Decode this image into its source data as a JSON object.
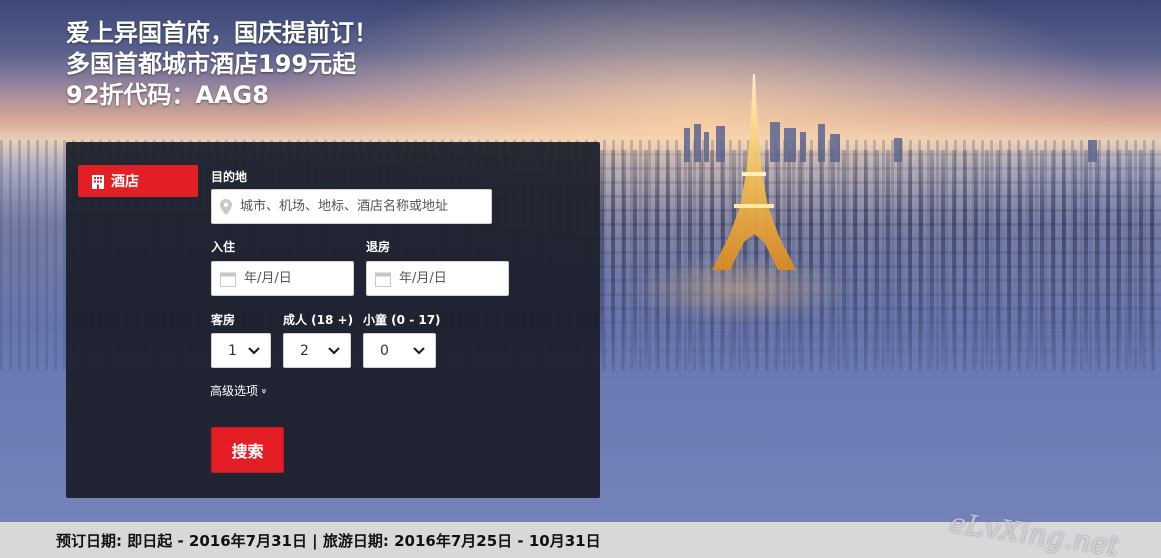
{
  "promo": {
    "line1": "爱上异国首府，国庆提前订！",
    "line2": "多国首都城市酒店199元起",
    "line3": "92折代码：AAG8"
  },
  "search_panel": {
    "tab_hotel_label": "酒店",
    "destination_label": "目的地",
    "destination_placeholder": "城市、机场、地标、酒店名称或地址",
    "checkin_label": "入住",
    "checkin_placeholder": "年/月/日",
    "checkout_label": "退房",
    "checkout_placeholder": "年/月/日",
    "rooms_label": "客房",
    "rooms_value": "1",
    "adults_label": "成人 (18 +)",
    "adults_value": "2",
    "children_label": "小童 (0 - 17)",
    "children_value": "0",
    "advanced_label": "高级选项",
    "advanced_chevron": "»",
    "search_button": "搜索"
  },
  "info_bar": {
    "text": "预订日期: 即日起 - 2016年7月31日 | 旅游日期: 2016年7月25日 - 10月31日"
  },
  "watermark": "eLvXing.net",
  "colors": {
    "accent_red": "#e31e24",
    "panel_bg": "#1c1f2a",
    "info_bar_bg": "#d8d8d8"
  },
  "icons": {
    "hotel_tab": "building-icon",
    "destination": "map-pin-icon",
    "dates": "calendar-icon",
    "selects": "chevron-down-icon"
  }
}
